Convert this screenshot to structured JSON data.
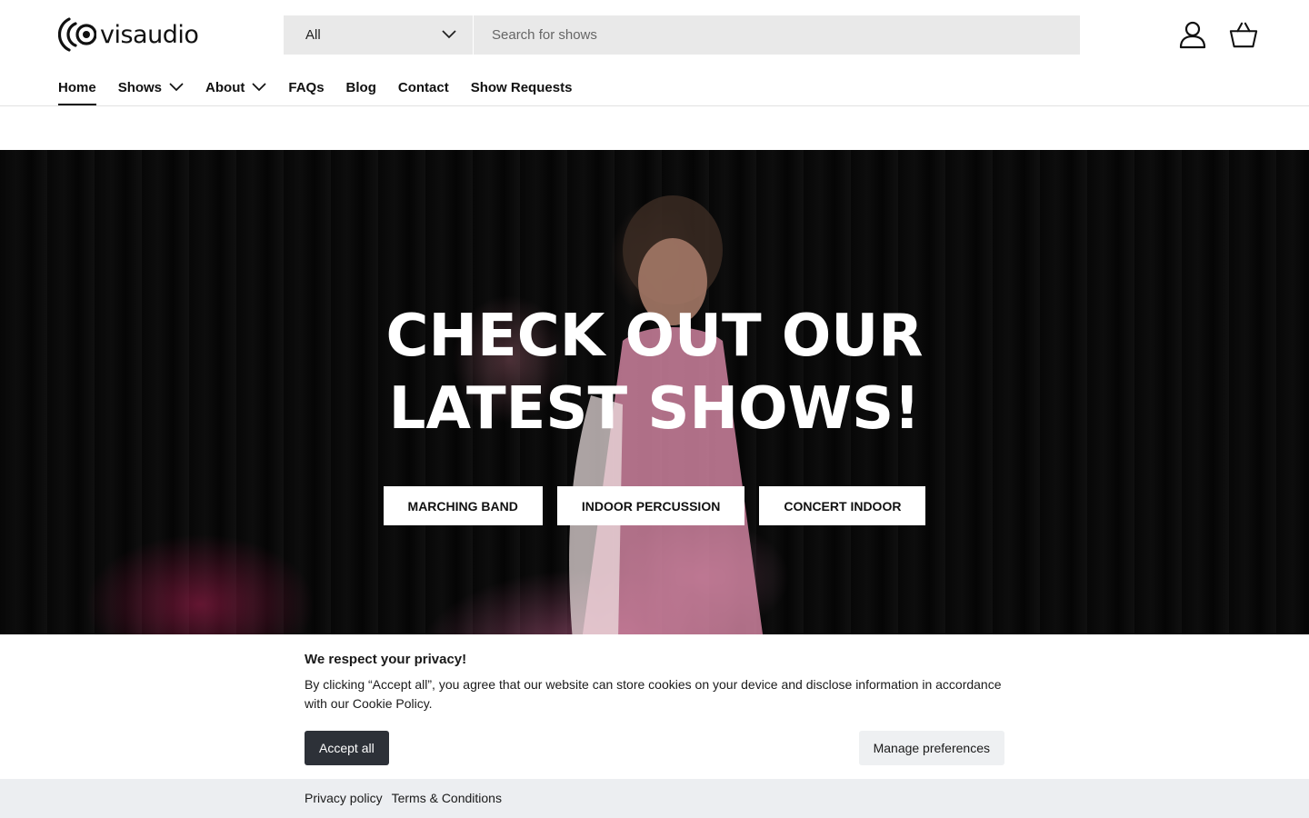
{
  "brand": {
    "name": "visaudio",
    "logo_icon": "sound-waves-icon"
  },
  "search": {
    "category_selected": "All",
    "placeholder": "Search for shows",
    "value": ""
  },
  "header_icons": {
    "account": "user-icon",
    "cart": "basket-icon"
  },
  "nav": {
    "items": [
      {
        "label": "Home",
        "active": true,
        "has_dropdown": false
      },
      {
        "label": "Shows",
        "active": false,
        "has_dropdown": true
      },
      {
        "label": "About",
        "active": false,
        "has_dropdown": true
      },
      {
        "label": "FAQs",
        "active": false,
        "has_dropdown": false
      },
      {
        "label": "Blog",
        "active": false,
        "has_dropdown": false
      },
      {
        "label": "Contact",
        "active": false,
        "has_dropdown": false
      },
      {
        "label": "Show Requests",
        "active": false,
        "has_dropdown": false
      }
    ]
  },
  "hero": {
    "title_line1": "CHECK OUT OUR",
    "title_line2": "LATEST SHOWS!",
    "buttons": [
      "MARCHING BAND",
      "INDOOR PERCUSSION",
      "CONCERT INDOOR"
    ]
  },
  "cookie": {
    "title": "We respect your privacy!",
    "text": "By clicking “Accept all”, you agree that our website can store cookies on your device and disclose information in accordance with our Cookie Policy.",
    "accept_label": "Accept all",
    "manage_label": "Manage preferences",
    "links": [
      "Privacy policy",
      "Terms & Conditions"
    ]
  },
  "colors": {
    "accept_button": "#2d3138",
    "search_bg": "#e9e9e9",
    "cookie_footer_bg": "#eceef1"
  }
}
